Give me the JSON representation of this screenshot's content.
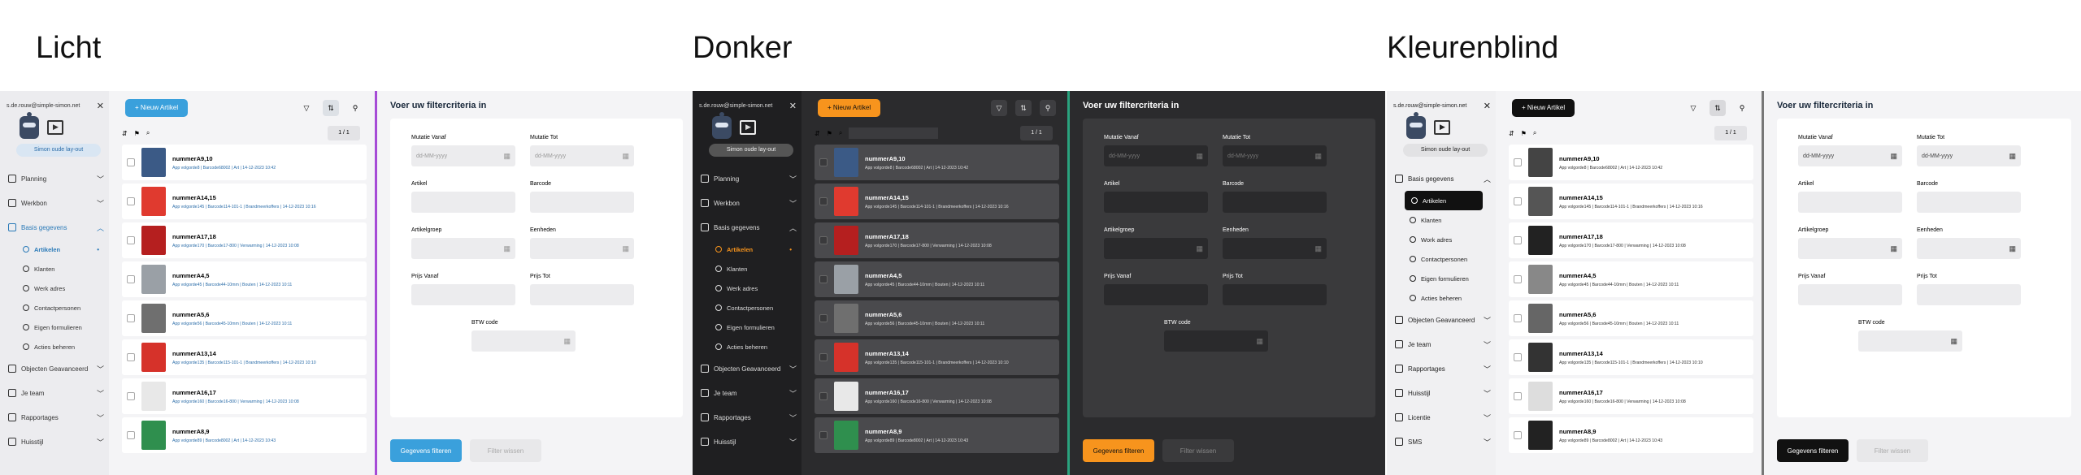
{
  "themes": [
    {
      "key": "light",
      "title": "Licht",
      "user_email": "s.de.rouw@simple-simon.net",
      "layout_button": "Simon oude lay-out",
      "nav": [
        {
          "label": "Planning",
          "open": false
        },
        {
          "label": "Werkbon",
          "open": false
        },
        {
          "label": "Basis gegevens",
          "open": true
        }
      ],
      "sub_items": [
        "Artikelen",
        "Klanten",
        "Werk adres",
        "Contactpersonen",
        "Eigen formulieren",
        "Acties beheren"
      ],
      "nav_after": [
        "Objecten Geavanceerd",
        "Je team",
        "Rapportages",
        "Huisstijl"
      ],
      "new_button": "Nieuw Artikel",
      "pager": "1 / 1",
      "items": [
        {
          "title": "nummerA9,10",
          "sub": "App volgorde8 | Barcode68002 | Art | 14-12-2023 10:42"
        },
        {
          "title": "nummerA14,15",
          "sub": "App volgorde145 | Barcode114-101-1 | Brandmeerkoffers | 14-12-2023 10:16"
        },
        {
          "title": "nummerA17,18",
          "sub": "App volgorde170 | Barcode17-800 | Verwarming | 14-12-2023 10:08"
        },
        {
          "title": "nummerA4,5",
          "sub": "App volgorde45 | Barcode44-10mm | Bouten | 14-12-2023 10:11"
        },
        {
          "title": "nummerA5,6",
          "sub": "App volgorde56 | Barcode45-10mm | Bouten | 14-12-2023 10:11"
        },
        {
          "title": "nummerA13,14",
          "sub": "App volgorde135 | Barcode115-101-1 | Brandmeerkoffers | 14-12-2023 10:10"
        },
        {
          "title": "nummerA16,17",
          "sub": "App volgorde160 | Barcode16-800 | Verwarming | 14-12-2023 10:08"
        },
        {
          "title": "nummerA8,9",
          "sub": "App volgorde89 | Barcode8002 | Art | 14-12-2023 10:43"
        }
      ],
      "filter_title": "Voer uw filtercriteria in",
      "fields": [
        {
          "label": "Mutatie Vanaf",
          "placeholder": "dd-MM-yyyy",
          "calendar": true
        },
        {
          "label": "Mutatie Tot",
          "placeholder": "dd-MM-yyyy",
          "calendar": true
        },
        {
          "label": "Artikel",
          "placeholder": "",
          "calendar": false
        },
        {
          "label": "Barcode",
          "placeholder": "",
          "calendar": false
        },
        {
          "label": "Artikelgroep",
          "placeholder": "",
          "calendar": true
        },
        {
          "label": "Eenheden",
          "placeholder": "",
          "calendar": true
        },
        {
          "label": "Prijs Vanaf",
          "placeholder": "",
          "calendar": false
        },
        {
          "label": "Prijs Tot",
          "placeholder": "",
          "calendar": false
        }
      ],
      "btw_label": "BTW code",
      "btn_filter": "Gegevens filteren",
      "btn_clear": "Filter wissen"
    },
    {
      "key": "dark",
      "title": "Donker",
      "user_email": "s.de.rouw@simple-simon.net",
      "layout_button": "Simon oude lay-out",
      "nav": [
        {
          "label": "Planning",
          "open": false
        },
        {
          "label": "Werkbon",
          "open": false
        },
        {
          "label": "Basis gegevens",
          "open": true
        }
      ],
      "sub_items": [
        "Artikelen",
        "Klanten",
        "Werk adres",
        "Contactpersonen",
        "Eigen formulieren",
        "Acties beheren"
      ],
      "nav_after": [
        "Objecten Geavanceerd",
        "Je team",
        "Rapportages",
        "Huisstijl"
      ],
      "new_button": "Nieuw Artikel",
      "pager": "1 / 1",
      "items": [
        {
          "title": "nummerA9,10",
          "sub": "App volgorde8 | Barcode68002 | Art | 14-12-2023 10:42"
        },
        {
          "title": "nummerA14,15",
          "sub": "App volgorde145 | Barcode114-101-1 | Brandmeerkoffers | 14-12-2023 10:16"
        },
        {
          "title": "nummerA17,18",
          "sub": "App volgorde170 | Barcode17-800 | Verwarming | 14-12-2023 10:08"
        },
        {
          "title": "nummerA4,5",
          "sub": "App volgorde45 | Barcode44-10mm | Bouten | 14-12-2023 10:11"
        },
        {
          "title": "nummerA5,6",
          "sub": "App volgorde56 | Barcode45-10mm | Bouten | 14-12-2023 10:11"
        },
        {
          "title": "nummerA13,14",
          "sub": "App volgorde135 | Barcode115-101-1 | Brandmeerkoffers | 14-12-2023 10:10"
        },
        {
          "title": "nummerA16,17",
          "sub": "App volgorde160 | Barcode16-800 | Verwarming | 14-12-2023 10:08"
        },
        {
          "title": "nummerA8,9",
          "sub": "App volgorde89 | Barcode8002 | Art | 14-12-2023 10:43"
        }
      ],
      "filter_title": "Voer uw filtercriteria in",
      "fields": [
        {
          "label": "Mutatie Vanaf",
          "placeholder": "dd-MM-yyyy",
          "calendar": true
        },
        {
          "label": "Mutatie Tot",
          "placeholder": "dd-MM-yyyy",
          "calendar": true
        },
        {
          "label": "Artikel",
          "placeholder": "",
          "calendar": false
        },
        {
          "label": "Barcode",
          "placeholder": "",
          "calendar": false
        },
        {
          "label": "Artikelgroep",
          "placeholder": "",
          "calendar": true
        },
        {
          "label": "Eenheden",
          "placeholder": "",
          "calendar": true
        },
        {
          "label": "Prijs Vanaf",
          "placeholder": "",
          "calendar": false
        },
        {
          "label": "Prijs Tot",
          "placeholder": "",
          "calendar": false
        }
      ],
      "btw_label": "BTW code",
      "btn_filter": "Gegevens filteren",
      "btn_clear": "Filter wissen"
    },
    {
      "key": "cb",
      "title": "Kleurenblind",
      "user_email": "s.de.rouw@simple-simon.net",
      "layout_button": "Simon oude lay-out",
      "nav": [
        {
          "label": "Basis gegevens",
          "open": true
        }
      ],
      "sub_items": [
        "Artikelen",
        "Klanten",
        "Work adres",
        "Contactpersonen",
        "Eigen formulieren",
        "Acties beheren"
      ],
      "nav_after": [
        "Objecten Geavanceerd",
        "Je team",
        "Rapportages",
        "Huisstijl",
        "Licentie",
        "SMS"
      ],
      "new_button": "Nieuw Artikel",
      "pager": "1 / 1",
      "items": [
        {
          "title": "nummerA9,10",
          "sub": "App volgorde8 | Barcode68002 | Art | 14-12-2023 10:42"
        },
        {
          "title": "nummerA14,15",
          "sub": "App volgorde145 | Barcode114-101-1 | Brandmeerkoffers | 14-12-2023 10:16"
        },
        {
          "title": "nummerA17,18",
          "sub": "App volgorde170 | Barcode17-800 | Verwarming | 14-12-2023 10:08"
        },
        {
          "title": "nummerA4,5",
          "sub": "App volgorde45 | Barcode44-10mm | Bouten | 14-12-2023 10:11"
        },
        {
          "title": "nummerA5,6",
          "sub": "App volgorde56 | Barcode45-10mm | Bouten | 14-12-2023 10:11"
        },
        {
          "title": "nummerA13,14",
          "sub": "App volgorde135 | Barcode115-101-1 | Brandmeerkoffers | 14-12-2023 10:10"
        },
        {
          "title": "nummerA16,17",
          "sub": "App volgorde160 | Barcode16-800 | Verwarming | 14-12-2023 10:08"
        },
        {
          "title": "nummerA8,9",
          "sub": "App volgorde89 | Barcode8002 | Art | 14-12-2023 10:43"
        }
      ],
      "filter_title": "Voer uw filtercriteria in",
      "fields": [
        {
          "label": "Mutatie Vanaf",
          "placeholder": "dd-MM-yyyy",
          "calendar": true
        },
        {
          "label": "Mutatie Tot",
          "placeholder": "dd-MM-yyyy",
          "calendar": true
        },
        {
          "label": "Artikel",
          "placeholder": "",
          "calendar": false
        },
        {
          "label": "Barcode",
          "placeholder": "",
          "calendar": false
        },
        {
          "label": "Artikelgroep",
          "placeholder": "",
          "calendar": true
        },
        {
          "label": "Eenheden",
          "placeholder": "",
          "calendar": true
        },
        {
          "label": "Prijs Vanaf",
          "placeholder": "",
          "calendar": false
        },
        {
          "label": "Prijs Tot",
          "placeholder": "",
          "calendar": false
        }
      ],
      "btw_label": "BTW code",
      "btn_filter": "Gegevens filteren",
      "btn_clear": "Filter wissen"
    }
  ],
  "thumb_colors": [
    "#3b5a86",
    "#e03a2f",
    "#b51f1f",
    "#9aa0a6",
    "#6f6f6f",
    "#d6322a",
    "#e8e8e8",
    "#2f8f4e"
  ],
  "thumb_colors_cb": [
    "#444444",
    "#555555",
    "#222222",
    "#888888",
    "#666666",
    "#333333",
    "#dddddd",
    "#222222"
  ]
}
